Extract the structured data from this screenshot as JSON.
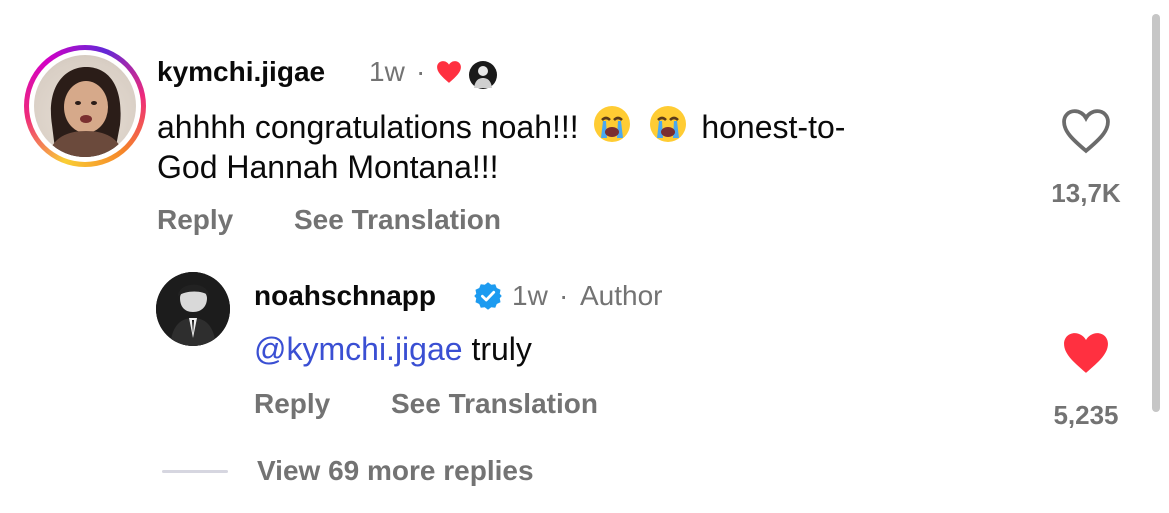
{
  "comment": {
    "username": "kymchi.jigae",
    "time": "1w",
    "separator": "·",
    "text_part1": "ahhhh congratulations noah!!!",
    "text_part2": "honest-to-",
    "text_line2": "God Hannah Montana!!!",
    "reply_label": "Reply",
    "translate_label": "See Translation",
    "like_count": "13,7K",
    "liked_by_author": true
  },
  "reply": {
    "username": "noahschnapp",
    "verified": true,
    "time": "1w",
    "separator": "·",
    "author_label": "Author",
    "mention": "@kymchi.jigae",
    "text": "truly",
    "reply_label": "Reply",
    "translate_label": "See Translation",
    "like_count": "5,235",
    "liked": true
  },
  "view_more_label": "View 69 more replies",
  "colors": {
    "heart_red": "#ff3040",
    "mention_blue": "#3a4fd3",
    "verified_blue": "#1d9bf0",
    "secondary_text": "#737373"
  },
  "icons": {
    "emoji": "loudly-crying-face",
    "like": "heart-outline-icon",
    "liked": "heart-filled-icon"
  }
}
